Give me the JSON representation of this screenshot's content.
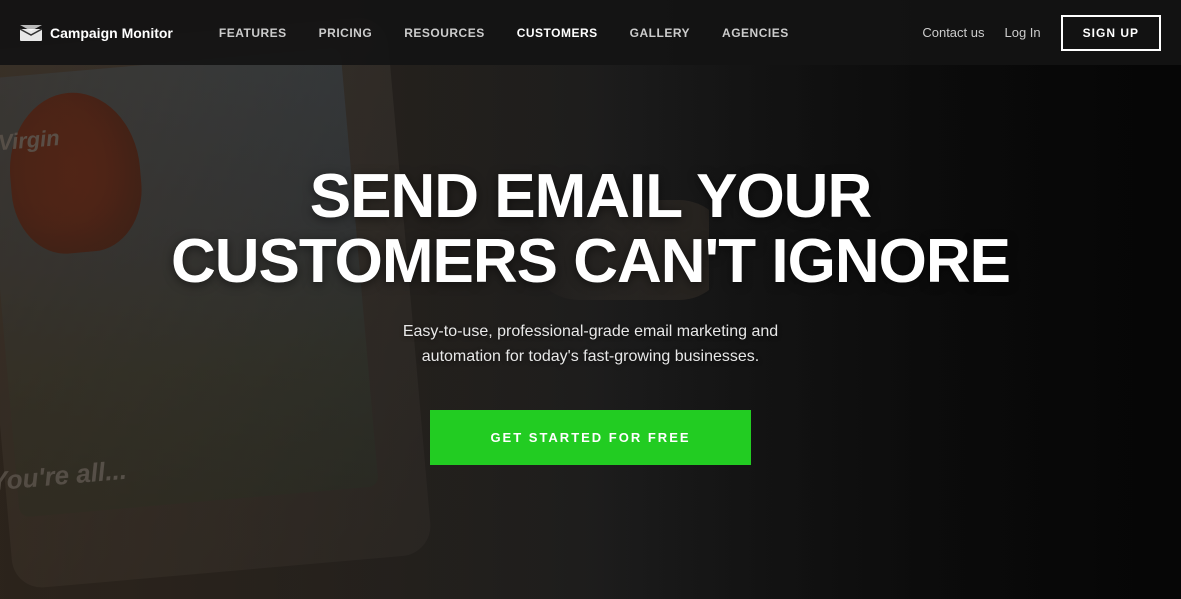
{
  "brand": {
    "name": "Campaign Monitor",
    "logo_icon": "✉"
  },
  "nav": {
    "links": [
      {
        "id": "features",
        "label": "FEATURES"
      },
      {
        "id": "pricing",
        "label": "PRICING"
      },
      {
        "id": "resources",
        "label": "RESOURCES"
      },
      {
        "id": "customers",
        "label": "CUSTOMERS",
        "active": true
      },
      {
        "id": "gallery",
        "label": "GALLERY"
      },
      {
        "id": "agencies",
        "label": "AGENCIES"
      }
    ],
    "contact_label": "Contact us",
    "login_label": "Log In",
    "signup_label": "SIGN UP"
  },
  "hero": {
    "title": "SEND EMAIL YOUR CUSTOMERS CAN'T IGNORE",
    "subtitle": "Easy-to-use, professional-grade email marketing and automation for today's fast-growing businesses.",
    "cta_label": "GET STARTED FOR FREE",
    "balloon_text": "Virgin",
    "phone_text": "You're all..."
  }
}
